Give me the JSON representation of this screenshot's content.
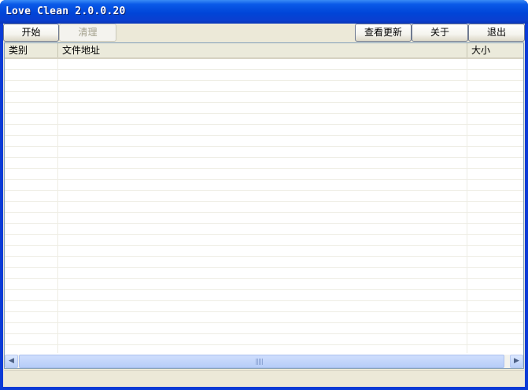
{
  "window": {
    "title": "Love Clean 2.0.0.20"
  },
  "toolbar": {
    "start_label": "开始",
    "clean_label": "清理",
    "check_update_label": "查看更新",
    "about_label": "关于",
    "exit_label": "退出"
  },
  "file_list": {
    "columns": [
      {
        "label": "类别"
      },
      {
        "label": "文件地址"
      },
      {
        "label": "大小"
      }
    ],
    "rows": []
  },
  "scrollbar": {
    "left_arrow": "◀",
    "right_arrow": "▶"
  },
  "colors": {
    "titlebar": "#0a5ae8",
    "client_bg": "#ece9d8"
  }
}
